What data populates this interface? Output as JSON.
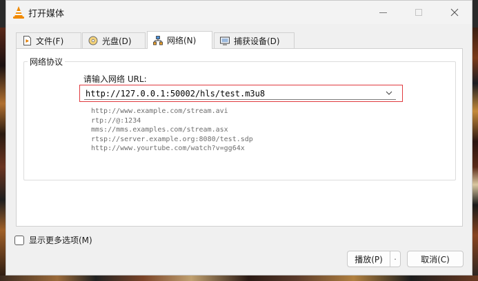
{
  "window": {
    "title": "打开媒体",
    "controls": [
      "minimize",
      "maximize",
      "close"
    ]
  },
  "tabs": [
    {
      "label": "文件(F)",
      "icon": "file-media-icon",
      "active": false
    },
    {
      "label": "光盘(D)",
      "icon": "disc-icon",
      "active": false
    },
    {
      "label": "网络(N)",
      "icon": "network-icon",
      "active": true
    },
    {
      "label": "捕获设备(D)",
      "icon": "capture-device-icon",
      "active": false
    }
  ],
  "network": {
    "group_title": "网络协议",
    "url_label": "请输入网络 URL:",
    "url_value": "http://127.0.0.1:50002/hls/test.m3u8",
    "examples": [
      "http://www.example.com/stream.avi",
      "rtp://@:1234",
      "mms://mms.examples.com/stream.asx",
      "rtsp://server.example.org:8080/test.sdp",
      "http://www.yourtube.com/watch?v=gg64x"
    ]
  },
  "options": {
    "show_more_label": "显示更多选项(M)",
    "show_more_checked": false
  },
  "buttons": {
    "play": "播放(P)",
    "cancel": "取消(C)"
  },
  "colors": {
    "highlight_border": "#e0393e",
    "vlc_orange": "#f08a00"
  }
}
